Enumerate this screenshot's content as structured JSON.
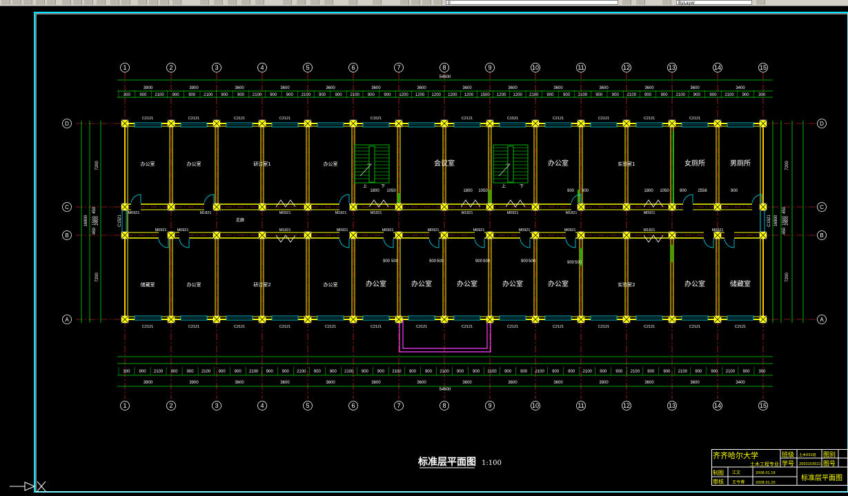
{
  "toolbar": {
    "layer_combo": "0",
    "style_combo": "ByLayer"
  },
  "drawing": {
    "title": "标准层平面图",
    "scale": "1:100",
    "overall_dim_top": "54600",
    "overall_dim_bottom": "54600",
    "axis_numbers": [
      "1",
      "2",
      "3",
      "4",
      "5",
      "6",
      "7",
      "8",
      "9",
      "10",
      "11",
      "12",
      "13",
      "14",
      "15"
    ],
    "axis_letters": [
      "D",
      "C",
      "B",
      "A"
    ],
    "bay_dims_top": [
      "3900",
      "3900",
      "3600",
      "3600",
      "3600",
      "3600",
      "3600",
      "3600",
      "3600",
      "3600",
      "3600",
      "3600",
      "3600",
      "3400"
    ],
    "bay_dims_bottom": [
      "3900",
      "3900",
      "3600",
      "3600",
      "3600",
      "3600",
      "3600",
      "3600",
      "3600",
      "3600",
      "3900",
      "3600",
      "3600",
      "3400"
    ],
    "sub_dims_top": [
      "300",
      "900",
      "2100",
      "900",
      "900",
      "2100",
      "900",
      "900",
      "2100",
      "900",
      "900",
      "2100",
      "900",
      "900",
      "2100",
      "900",
      "900",
      "1200",
      "1200",
      "1200",
      "1200",
      "1200",
      "1500",
      "1200",
      "1200",
      "2100",
      "900",
      "900",
      "2100",
      "900",
      "900",
      "2100",
      "900",
      "900",
      "2100",
      "900",
      "900",
      "2100",
      "900",
      "300"
    ],
    "sub_dims_bottom": [
      "300",
      "900",
      "2100",
      "900",
      "900",
      "2100",
      "900",
      "900",
      "2100",
      "900",
      "900",
      "2100",
      "900",
      "900",
      "2100",
      "900",
      "900",
      "2100",
      "900",
      "900",
      "2100",
      "900",
      "900",
      "2100",
      "900",
      "900",
      "2100",
      "900",
      "900",
      "2100",
      "900",
      "900",
      "2100",
      "900",
      "900",
      "2100",
      "900",
      "900",
      "2100",
      "900",
      "300"
    ],
    "side_dims_left": [
      "7200",
      "2400",
      "7200",
      "16800",
      "450",
      "1500",
      "450"
    ],
    "side_dims_right": [
      "7200",
      "2400",
      "7200",
      "16800",
      "450",
      "1500",
      "450"
    ],
    "rooms_top": [
      "办公室",
      "办公室",
      "研讨室1",
      "办公室",
      "",
      "会议室",
      "",
      "办公室",
      "实验室1",
      "女厕所",
      "男厕所"
    ],
    "rooms_bottom": [
      "储藏室",
      "办公室",
      "研讨室2",
      "办公室",
      "办公室",
      "办公室",
      "办公室",
      "办公室",
      "办公室",
      "实验室2",
      "办公室",
      "储藏室"
    ],
    "corridor_label": "走廊",
    "stair_up": "上",
    "stair_down": "下",
    "window_tags_top": [
      "C2121",
      "C2121",
      "C2121",
      "C2121",
      "C1521",
      "C2121",
      "C1521",
      "C2121",
      "C2121",
      "C2121",
      "C2121"
    ],
    "window_tags_bottom": [
      "C2121",
      "C2121",
      "C2121",
      "C2121",
      "C2121",
      "C2121",
      "C2121",
      "C2121",
      "C2121",
      "C2121",
      "C2121",
      "C2121",
      "C2121",
      "C2121"
    ],
    "door_tags_c": [
      "M0921",
      "M1821",
      "M0921",
      "M1821",
      "M1821",
      "M1821",
      "M0921",
      "M1821",
      "M0921"
    ],
    "door_tags_b": [
      "M0921",
      "M0921",
      "M1821",
      "M0921",
      "M0921",
      "M0921",
      "M0921",
      "M0921",
      "M0921",
      "M1821",
      "M0921"
    ],
    "misc_dims": [
      "1800",
      "1050",
      "1800",
      "1050",
      "900",
      "900",
      "1800",
      "1050",
      "900",
      "2556",
      "900",
      "900",
      "500",
      "900",
      "500",
      "900",
      "500",
      "900",
      "500",
      "900",
      "500",
      "C1521",
      "C1521"
    ]
  },
  "titleblock": {
    "school": "齐齐哈尔大学",
    "major": "土木工程专业",
    "r1c1": "班级",
    "r1c2": "土木031班",
    "r1c3": "图别",
    "r2c1": "学号",
    "r2c2": "2003103021",
    "r2c3": "图号",
    "draw_label": "制图",
    "draw_name": "江文",
    "draw_date": "2008.01.18",
    "check_label": "审核",
    "check_name": "王今博",
    "check_date": "2008.01.20",
    "sheet_title": "标准层平面图"
  }
}
